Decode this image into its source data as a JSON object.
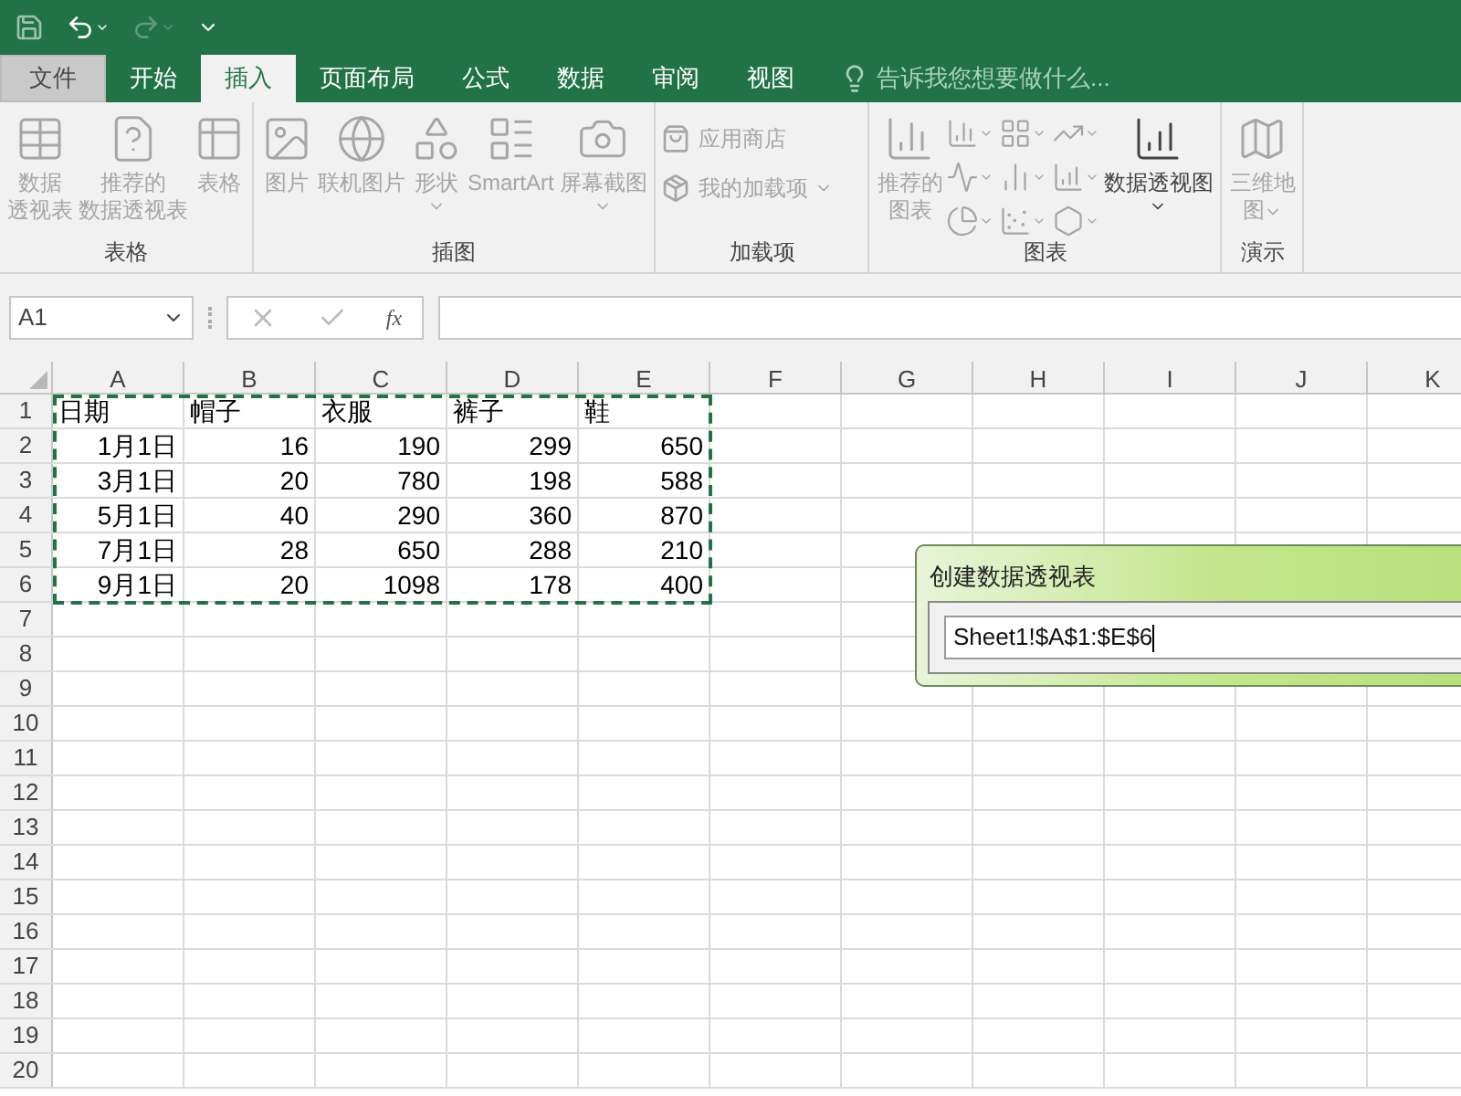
{
  "quick_access": {
    "redo": {
      "disabled": true
    }
  },
  "tabs": [
    {
      "label": "文件",
      "kind": "file",
      "selected": false
    },
    {
      "label": "开始",
      "kind": "tab",
      "selected": false
    },
    {
      "label": "插入",
      "kind": "tab",
      "selected": true
    },
    {
      "label": "页面布局",
      "kind": "tab",
      "selected": false
    },
    {
      "label": "公式",
      "kind": "tab",
      "selected": false
    },
    {
      "label": "数据",
      "kind": "tab",
      "selected": false
    },
    {
      "label": "审阅",
      "kind": "tab",
      "selected": false
    },
    {
      "label": "视图",
      "kind": "tab",
      "selected": false
    }
  ],
  "tell_me": {
    "placeholder": "告诉我您想要做什么..."
  },
  "ribbon_groups": [
    {
      "label": "表格",
      "buttons": [
        {
          "kind": "large",
          "lines": [
            "数据",
            "透视表"
          ],
          "disabled": true,
          "dropdown": false
        },
        {
          "kind": "large",
          "lines": [
            "推荐的",
            "数据透视表"
          ],
          "disabled": true,
          "dropdown": false
        },
        {
          "kind": "large",
          "lines": [
            "表格"
          ],
          "disabled": true,
          "dropdown": false
        }
      ]
    },
    {
      "label": "插图",
      "buttons": [
        {
          "kind": "large",
          "lines": [
            "图片"
          ],
          "disabled": true,
          "dropdown": false
        },
        {
          "kind": "large",
          "lines": [
            "联机图片"
          ],
          "disabled": true,
          "dropdown": false
        },
        {
          "kind": "large",
          "lines": [
            "形状"
          ],
          "disabled": true,
          "dropdown": true
        },
        {
          "kind": "large",
          "lines": [
            "SmartArt"
          ],
          "disabled": true,
          "dropdown": false
        },
        {
          "kind": "large",
          "lines": [
            "屏幕截图"
          ],
          "disabled": true,
          "dropdown": true
        }
      ]
    },
    {
      "label": "加载项",
      "buttons": [
        {
          "kind": "small",
          "lines": [
            "应用商店"
          ],
          "disabled": true,
          "dropdown": false
        },
        {
          "kind": "small",
          "lines": [
            "我的加载项"
          ],
          "disabled": true,
          "dropdown": true
        }
      ]
    },
    {
      "label": "图表",
      "buttons": [
        {
          "kind": "large",
          "lines": [
            "推荐的",
            "图表"
          ],
          "disabled": true,
          "dropdown": false
        },
        {
          "kind": "chartgrid",
          "disabled": true
        },
        {
          "kind": "large",
          "lines": [
            "数据透视图"
          ],
          "disabled": false,
          "dropdown": true
        }
      ]
    },
    {
      "label": "演示",
      "buttons": [
        {
          "kind": "large",
          "lines": [
            "三维地",
            "图"
          ],
          "disabled": true,
          "dropdown": true
        }
      ]
    }
  ],
  "name_box": "A1",
  "function_label": "fx",
  "columns": [
    "A",
    "B",
    "C",
    "D",
    "E",
    "F",
    "G",
    "H",
    "I",
    "J",
    "K"
  ],
  "rows": [
    {
      "number": "1",
      "kind": "header",
      "cells": [
        "日期",
        "帽子",
        "衣服",
        "裤子",
        "鞋"
      ]
    },
    {
      "number": "2",
      "kind": "data",
      "cells": [
        "1月1日",
        "16",
        "190",
        "299",
        "650"
      ]
    },
    {
      "number": "3",
      "kind": "data",
      "cells": [
        "3月1日",
        "20",
        "780",
        "198",
        "588"
      ]
    },
    {
      "number": "4",
      "kind": "data",
      "cells": [
        "5月1日",
        "40",
        "290",
        "360",
        "870"
      ]
    },
    {
      "number": "5",
      "kind": "data",
      "cells": [
        "7月1日",
        "28",
        "650",
        "288",
        "210"
      ]
    },
    {
      "number": "6",
      "kind": "data",
      "cells": [
        "9月1日",
        "20",
        "1098",
        "178",
        "400"
      ]
    },
    {
      "number": "7",
      "kind": "empty",
      "cells": []
    },
    {
      "number": "8",
      "kind": "empty",
      "cells": []
    },
    {
      "number": "9",
      "kind": "empty",
      "cells": []
    },
    {
      "number": "10",
      "kind": "empty",
      "cells": []
    },
    {
      "number": "11",
      "kind": "empty",
      "cells": []
    },
    {
      "number": "12",
      "kind": "empty",
      "cells": []
    },
    {
      "number": "13",
      "kind": "empty",
      "cells": []
    },
    {
      "number": "14",
      "kind": "empty",
      "cells": []
    },
    {
      "number": "15",
      "kind": "empty",
      "cells": []
    },
    {
      "number": "16",
      "kind": "empty",
      "cells": []
    },
    {
      "number": "17",
      "kind": "empty",
      "cells": []
    },
    {
      "number": "18",
      "kind": "empty",
      "cells": []
    },
    {
      "number": "19",
      "kind": "empty",
      "cells": []
    },
    {
      "number": "20",
      "kind": "empty",
      "cells": []
    }
  ],
  "dialog": {
    "title": "创建数据透视表",
    "value": "Sheet1!$A$1:$E$6"
  }
}
